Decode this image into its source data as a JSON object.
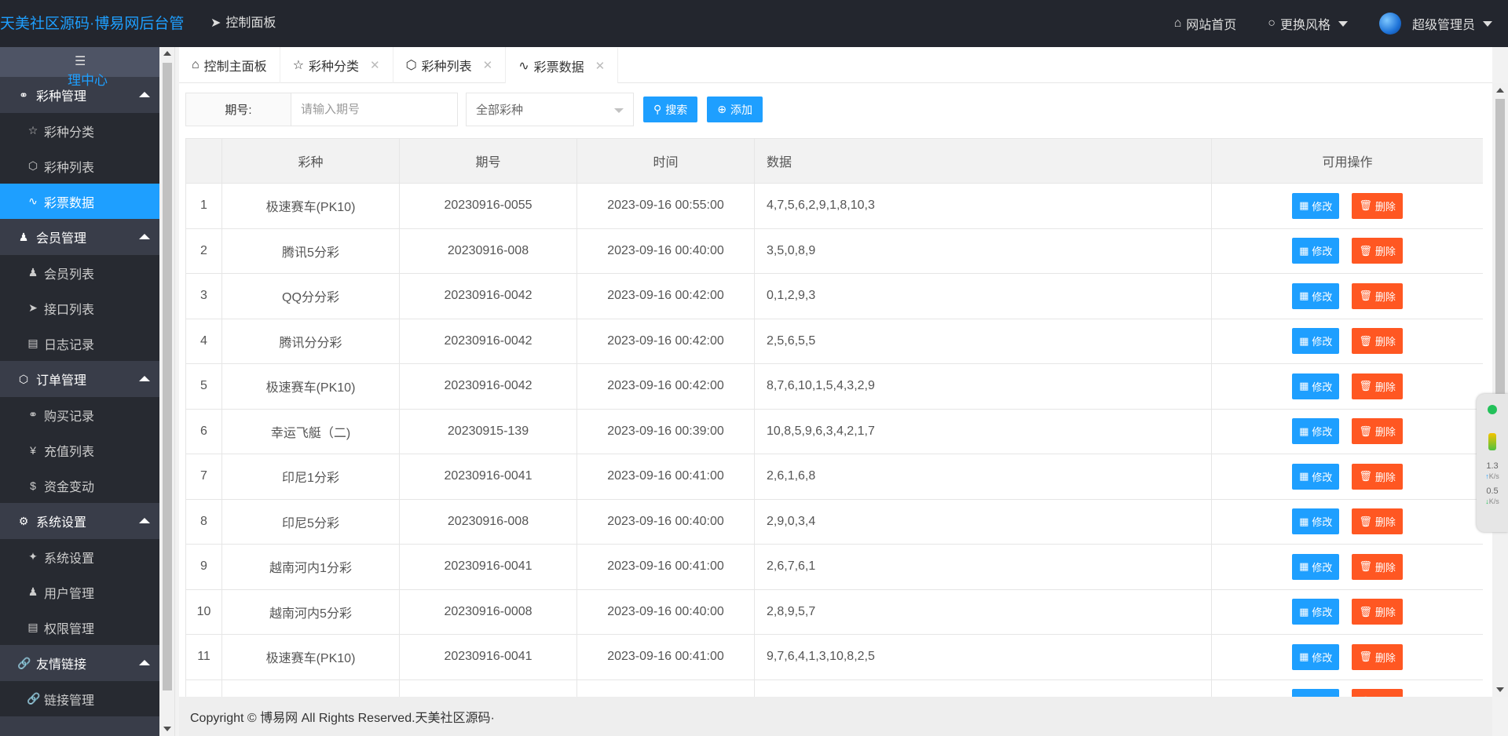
{
  "header": {
    "logo": "天美社区源码·博易网后台管",
    "dashboard_link": "控制面板",
    "site_home": "网站首页",
    "change_style": "更换风格",
    "admin_name": "超级管理员"
  },
  "sidebar": {
    "overflow_text": "理中心",
    "groups": [
      {
        "label": "彩种管理",
        "icon": "fire-icon",
        "items": [
          {
            "label": "彩种分类",
            "icon": "star-icon"
          },
          {
            "label": "彩种列表",
            "icon": "cube-icon"
          },
          {
            "label": "彩票数据",
            "icon": "pulse-icon",
            "active": true
          }
        ]
      },
      {
        "label": "会员管理",
        "icon": "users-icon",
        "items": [
          {
            "label": "会员列表",
            "icon": "user-icon"
          },
          {
            "label": "接口列表",
            "icon": "send-icon"
          },
          {
            "label": "日志记录",
            "icon": "log-icon"
          }
        ]
      },
      {
        "label": "订单管理",
        "icon": "cube-icon",
        "items": [
          {
            "label": "购买记录",
            "icon": "fire-icon"
          },
          {
            "label": "充值列表",
            "icon": "yen-icon"
          },
          {
            "label": "资金变动",
            "icon": "dollar-icon"
          }
        ]
      },
      {
        "label": "系统设置",
        "icon": "gear-icon",
        "items": [
          {
            "label": "系统设置",
            "icon": "tools-icon"
          },
          {
            "label": "用户管理",
            "icon": "user-icon"
          },
          {
            "label": "权限管理",
            "icon": "log-icon"
          }
        ]
      },
      {
        "label": "友情链接",
        "icon": "link-icon",
        "items": [
          {
            "label": "链接管理",
            "icon": "link-icon"
          }
        ]
      }
    ]
  },
  "tabs": [
    {
      "label": "控制主面板",
      "icon": "home-icon",
      "closable": false
    },
    {
      "label": "彩种分类",
      "icon": "star-icon",
      "closable": true
    },
    {
      "label": "彩种列表",
      "icon": "cube-icon",
      "closable": true
    },
    {
      "label": "彩票数据",
      "icon": "pulse-icon",
      "closable": true,
      "active": true
    }
  ],
  "toolbar": {
    "period_label": "期号:",
    "period_placeholder": "请输入期号",
    "lottery_select": "全部彩种",
    "search_label": "搜索",
    "add_label": "添加"
  },
  "table": {
    "headers": [
      "",
      "彩种",
      "期号",
      "时间",
      "数据",
      "可用操作"
    ],
    "edit_label": "修改",
    "delete_label": "删除",
    "rows": [
      [
        "1",
        "极速赛车(PK10)",
        "20230916-0055",
        "2023-09-16 00:55:00",
        "4,7,5,6,2,9,1,8,10,3"
      ],
      [
        "2",
        "腾讯5分彩",
        "20230916-008",
        "2023-09-16 00:40:00",
        "3,5,0,8,9"
      ],
      [
        "3",
        "QQ分分彩",
        "20230916-0042",
        "2023-09-16 00:42:00",
        "0,1,2,9,3"
      ],
      [
        "4",
        "腾讯分分彩",
        "20230916-0042",
        "2023-09-16 00:42:00",
        "2,5,6,5,5"
      ],
      [
        "5",
        "极速赛车(PK10)",
        "20230916-0042",
        "2023-09-16 00:42:00",
        "8,7,6,10,1,5,4,3,2,9"
      ],
      [
        "6",
        "幸运飞艇（二)",
        "20230915-139",
        "2023-09-16 00:39:00",
        "10,8,5,9,6,3,4,2,1,7"
      ],
      [
        "7",
        "印尼1分彩",
        "20230916-0041",
        "2023-09-16 00:41:00",
        "2,6,1,6,8"
      ],
      [
        "8",
        "印尼5分彩",
        "20230916-008",
        "2023-09-16 00:40:00",
        "2,9,0,3,4"
      ],
      [
        "9",
        "越南河内1分彩",
        "20230916-0041",
        "2023-09-16 00:41:00",
        "2,6,7,6,1"
      ],
      [
        "10",
        "越南河内5分彩",
        "20230916-0008",
        "2023-09-16 00:40:00",
        "2,8,9,5,7"
      ],
      [
        "11",
        "极速赛车(PK10)",
        "20230916-0041",
        "2023-09-16 00:41:00",
        "9,7,6,4,1,3,10,8,2,5"
      ],
      [
        "",
        "",
        "",
        "",
        ""
      ]
    ]
  },
  "net_widget": {
    "up": "1.3",
    "down": "0.5",
    "unit": "K/s"
  },
  "footer": {
    "copyright": "Copyright © 博易网 All Rights Reserved.天美社区源码·"
  },
  "colors": {
    "accent": "#1E9FFF",
    "danger": "#FF5722",
    "sidebar_bg": "#393d49",
    "header_bg": "#23262e"
  }
}
